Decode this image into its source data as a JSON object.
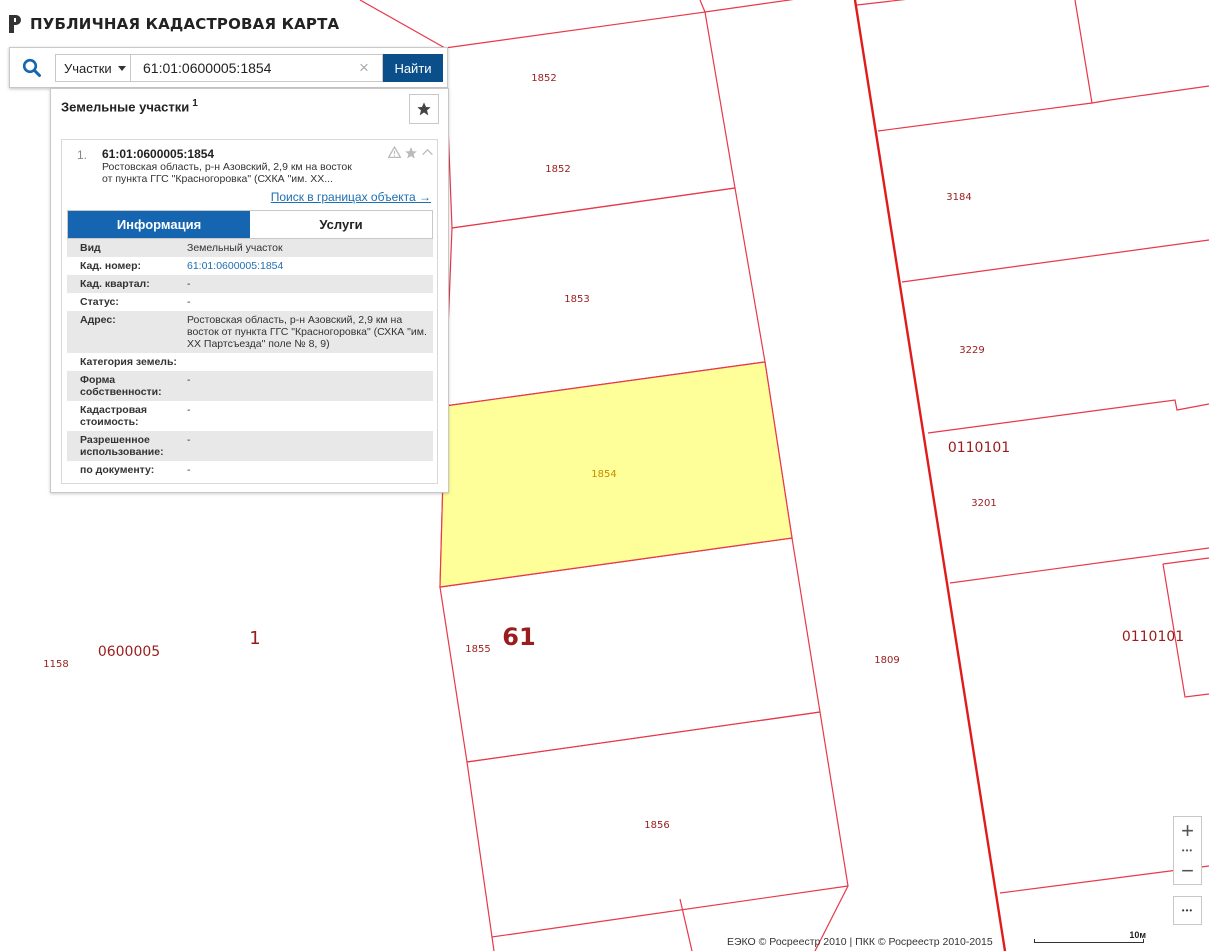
{
  "header": {
    "title": "ПУБЛИЧНАЯ КАДАСТРОВАЯ КАРТА"
  },
  "search": {
    "type_label": "Участки",
    "query": "61:01:0600005:1854",
    "clear_symbol": "×",
    "find_label": "Найти"
  },
  "panel": {
    "title": "Земельные участки",
    "count": "1",
    "result": {
      "index": "1.",
      "cad_number": "61:01:0600005:1854",
      "address_line1": "Ростовская область, р-н Азовский, 2,9 км на восток",
      "address_line2": "от пункта ГГС \"Красногоровка\" (СХКА \"им. XX...",
      "bounds_link": "Поиск в границах объекта →",
      "tabs": {
        "info": "Информация",
        "services": "Услуги"
      },
      "rows": [
        {
          "key": "Вид",
          "value": "Земельный участок"
        },
        {
          "key": "Кад. номер:",
          "value": "61:01:0600005:1854"
        },
        {
          "key": "Кад. квартал:",
          "value": "-"
        },
        {
          "key": "Статус:",
          "value": "-"
        },
        {
          "key": "Адрес:",
          "value": "Ростовская область, р-н Азовский, 2,9 км на восток от пункта ГГС \"Красногоровка\" (СХКА \"им. XX Партсъезда\" поле № 8, 9)"
        },
        {
          "key": "Категория земель:",
          "value": ""
        },
        {
          "key": "Форма собственности:",
          "value": "-"
        },
        {
          "key": "Кадастровая стоимость:",
          "value": "-"
        },
        {
          "key": "Разрешенное использование:",
          "value": "-"
        },
        {
          "key": "по документу:",
          "value": "-"
        }
      ]
    }
  },
  "map": {
    "parcel_labels": [
      "1852",
      "1852",
      "1853",
      "1854",
      "1855",
      "1856",
      "3184",
      "3229",
      "3201",
      "1809",
      "1158"
    ],
    "quarter_labels": [
      "0110101",
      "0110101",
      "0600005"
    ],
    "district_label": "1",
    "region_label": "61"
  },
  "controls": {
    "zoom_in": "+",
    "zoom_out": "−",
    "more": "•••"
  },
  "footer": {
    "copyright": "ЕЭКО © Росреестр 2010 | ПКК © Росреестр 2010-2015",
    "scale": "10м"
  },
  "colors": {
    "parcel_line": "#e8384a",
    "parcel_label": "#9b1c1c",
    "highlight_fill": "#ffff99",
    "accent": "#1565b0",
    "button": "#0b4f8a",
    "link": "#1f6fb2"
  }
}
